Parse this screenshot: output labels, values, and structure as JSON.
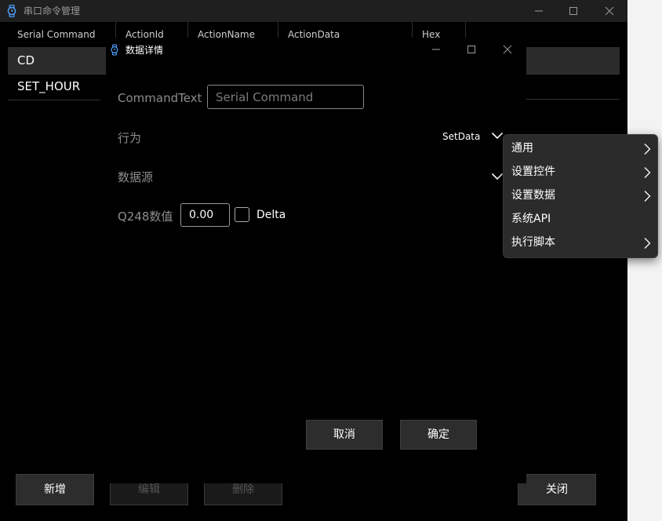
{
  "main_window": {
    "title": "串口命令管理",
    "columns": [
      "Serial Command",
      "ActionId",
      "ActionName",
      "ActionData",
      "Hex"
    ],
    "rows": [
      {
        "serial_command": "CD"
      },
      {
        "serial_command": "SET_HOUR"
      }
    ],
    "buttons": {
      "add": "新增",
      "edit": "编辑",
      "delete": "删除",
      "close": "关闭"
    }
  },
  "dialog": {
    "title": "数据详情",
    "command_text_label": "CommandText",
    "command_text_placeholder": "Serial Command",
    "command_text_value": "",
    "action_label": "行为",
    "action_value": "SetData",
    "data_source_label": "数据源",
    "q248_label": "Q248数值",
    "q248_value": "0.00",
    "delta_label": "Delta",
    "delta_checked": false,
    "cancel": "取消",
    "ok": "确定"
  },
  "context_menu": {
    "items": [
      {
        "label": "通用",
        "submenu": true
      },
      {
        "label": "设置控件",
        "submenu": true
      },
      {
        "label": "设置数据",
        "submenu": true
      },
      {
        "label": "系统API",
        "submenu": false
      },
      {
        "label": "执行脚本",
        "submenu": true
      }
    ]
  },
  "colors": {
    "background": "#000000",
    "titlebar": "#1f1f1f",
    "selected_row": "#2b2b2b",
    "accent_icon": "#4ea1ff",
    "menu_bg": "#2b2b2b"
  },
  "icons": [
    "watch-icon",
    "minimize-icon",
    "maximize-icon",
    "close-icon",
    "chevron-down-icon",
    "chevron-right-icon"
  ]
}
